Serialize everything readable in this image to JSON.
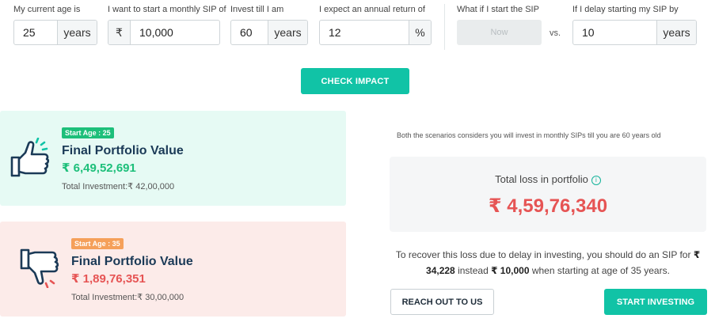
{
  "inputs": {
    "age": {
      "label": "My current age is",
      "value": "25",
      "suffix": "years"
    },
    "sip": {
      "label": "I want to start a monthly SIP of",
      "prefix": "₹",
      "value": "10,000"
    },
    "invest_till": {
      "label": "Invest till I am",
      "value": "60",
      "suffix": "years"
    },
    "return": {
      "label": "I expect an annual return of",
      "value": "12",
      "suffix": "%"
    },
    "start_when": {
      "label": "What if I start the SIP",
      "button": "Now"
    },
    "vs": "vs.",
    "delay": {
      "label": "If I delay starting my SIP by",
      "value": "10",
      "suffix": "years"
    }
  },
  "check_button": "CHECK IMPACT",
  "scenario_good": {
    "badge": "Start Age : 25",
    "title": "Final Portfolio Value",
    "value": "₹ 6,49,52,691",
    "investment": "Total Investment:₹ 42,00,000",
    "color": "#1dbf7a"
  },
  "scenario_bad": {
    "badge": "Start Age : 35",
    "title": "Final Portfolio Value",
    "value": "₹ 1,89,76,351",
    "investment": "Total Investment:₹ 30,00,000",
    "color": "#e65454"
  },
  "note": "Both the scenarios considers you will invest in monthly SIPs till you are 60 years old",
  "loss": {
    "label": "Total loss in portfolio",
    "info": "i",
    "value": "₹ 4,59,76,340"
  },
  "recover": {
    "part1": "To recover this loss due to delay in investing, you should do an SIP for ",
    "amount_new": "₹ 34,228",
    "part2": " instead ",
    "amount_old": "₹ 10,000",
    "part3": " when starting at age of 35 years."
  },
  "buttons": {
    "reach": "REACH OUT TO US",
    "start": "START INVESTING"
  },
  "icons": {
    "thumbs_up": "thumbs-up-icon",
    "thumbs_down": "thumbs-down-icon",
    "info": "info-icon"
  },
  "colors": {
    "accent": "#11c3a6",
    "good_bg": "#e6faf4",
    "bad_bg": "#fcebe9",
    "loss": "#e65454"
  }
}
